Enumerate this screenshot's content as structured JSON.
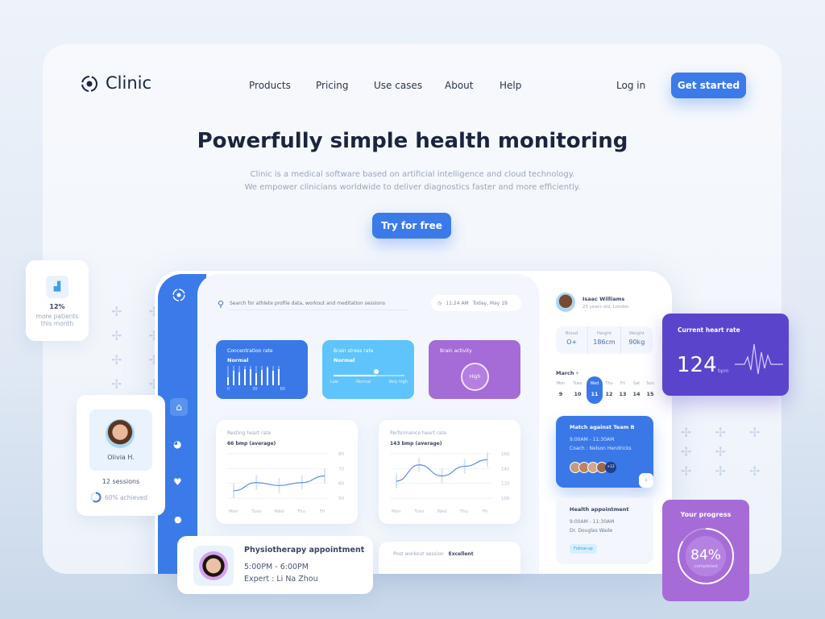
{
  "brand": {
    "name": "Clinic"
  },
  "nav": {
    "items": [
      "Products",
      "Pricing",
      "Use cases",
      "About",
      "Help"
    ],
    "login": "Log in",
    "cta": "Get started"
  },
  "hero": {
    "title": "Powerfully simple health monitoring",
    "subtitle_1": "Clinic is a medical software based on artificial intelligence and cloud technology.",
    "subtitle_2": "We empower clinicians worldwide to deliver diagnostics faster and more efficiently.",
    "cta": "Try for free"
  },
  "colors": {
    "primary": "#3b7be9",
    "sky": "#5ec4fb",
    "purple": "#a56bd6",
    "indigo": "#5b44cc"
  },
  "stat_card": {
    "value": "12%",
    "line1": "more patients",
    "line2": "this month"
  },
  "patient_card": {
    "name": "Olivia H.",
    "sessions": "12 sessions",
    "achieved": "60% achieved",
    "achieved_fraction": 0.6
  },
  "dashboard": {
    "search_placeholder": "Search for athlete profile data, workout and meditation sessions",
    "time": "11:24 AM",
    "date": "Today, May 19",
    "concentration": {
      "title": "Concentration rate",
      "status": "Normal",
      "ticks": [
        "0",
        "30",
        "60"
      ]
    },
    "stress": {
      "title": "Brain stress rate",
      "status": "Normal",
      "labels": [
        "Low",
        "Normal",
        "Very high"
      ],
      "level": 0.6
    },
    "brain": {
      "title": "Brain activity",
      "status": "High"
    },
    "resting": {
      "title": "Resting heart rate",
      "avg": "66 bmp (average)"
    },
    "performance": {
      "title": "Performance heart rate",
      "avg": "143 bmp (average)"
    },
    "physio": {
      "title": "Physiotherapy appointment",
      "time": "5:00PM - 6:00PM",
      "expert": "Expert : Li Na Zhou"
    },
    "post_workout": {
      "label": "Post workout session",
      "value": "Excellent"
    }
  },
  "chart_data": [
    {
      "type": "line",
      "title": "Resting heart rate",
      "categories": [
        "Mon",
        "Tues",
        "Wed",
        "Thu",
        "Fri"
      ],
      "values": [
        55,
        60.5,
        58.5,
        60.5,
        65
      ],
      "yticks": [
        "80",
        "70",
        "60",
        "50"
      ],
      "ylim": [
        50,
        80
      ],
      "grid": true
    },
    {
      "type": "line",
      "title": "Performance heart rate",
      "categories": [
        "Mon",
        "Tues",
        "Wed",
        "Thu",
        "Fri"
      ],
      "values": [
        123,
        145,
        130,
        143,
        152
      ],
      "yticks": [
        "160",
        "140",
        "120",
        "100"
      ],
      "ylim": [
        100,
        160
      ],
      "grid": true
    }
  ],
  "profile": {
    "name": "Isaac Williams",
    "info": "25 years old, London",
    "stats": [
      {
        "label": "Blood",
        "value": "O+"
      },
      {
        "label": "Height",
        "value": "186cm"
      },
      {
        "label": "Weight",
        "value": "90kg"
      }
    ]
  },
  "calendar": {
    "month": "March",
    "days": [
      {
        "d": "Mon",
        "n": "9"
      },
      {
        "d": "Tues",
        "n": "10"
      },
      {
        "d": "Wed",
        "n": "11"
      },
      {
        "d": "Thu",
        "n": "12"
      },
      {
        "d": "Fri",
        "n": "13"
      },
      {
        "d": "Sat",
        "n": "14"
      },
      {
        "d": "Sun",
        "n": "15"
      }
    ]
  },
  "match": {
    "title": "Match against Team B",
    "time": "9:00AM - 11:30AM",
    "coach": "Coach : Nelson Hendricks",
    "more": "+12"
  },
  "health": {
    "title": "Health appointment",
    "time": "9:00AM - 11:30AM",
    "doctor": "Dr. Douglas Wade",
    "tag": "Follow-up"
  },
  "heart": {
    "title": "Current heart rate",
    "value": "124",
    "unit": "bpm"
  },
  "progress": {
    "title": "Your progress",
    "value": "84%",
    "label": "completed",
    "fraction": 0.84
  }
}
